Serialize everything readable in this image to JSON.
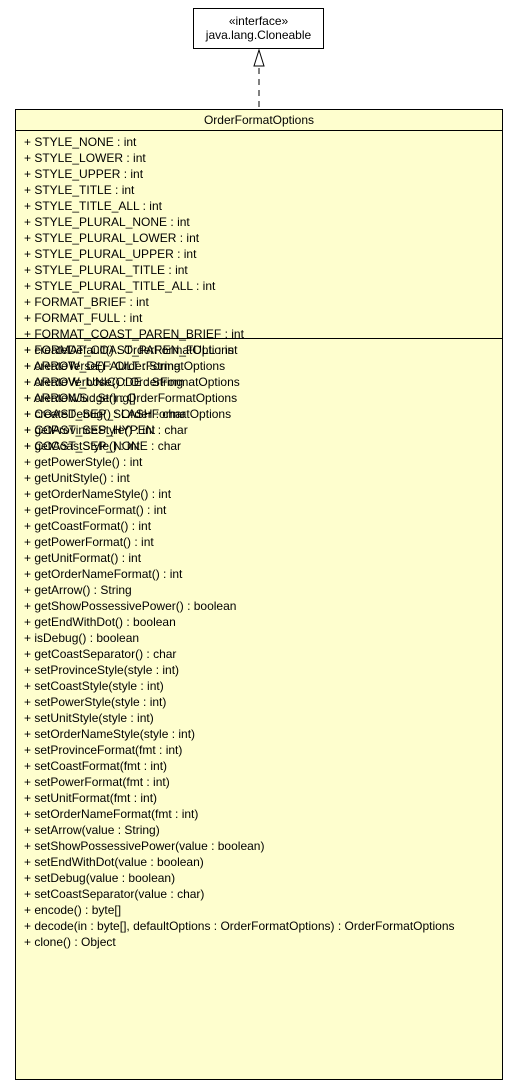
{
  "interface": {
    "stereotype": "«interface»",
    "name": "java.lang.Cloneable"
  },
  "class": {
    "name": "OrderFormatOptions",
    "attributes": [
      "+ STYLE_NONE : int",
      "+ STYLE_LOWER : int",
      "+ STYLE_UPPER : int",
      "+ STYLE_TITLE : int",
      "+ STYLE_TITLE_ALL : int",
      "+ STYLE_PLURAL_NONE : int",
      "+ STYLE_PLURAL_LOWER : int",
      "+ STYLE_PLURAL_UPPER : int",
      "+ STYLE_PLURAL_TITLE : int",
      "+ STYLE_PLURAL_TITLE_ALL : int",
      "+ FORMAT_BRIEF : int",
      "+ FORMAT_FULL : int",
      "+ FORMAT_COAST_PAREN_BRIEF : int",
      "+ FORMAT_COAST_PAREN_FULL : int",
      "+ ARROW_DEFAULT : String",
      "+ ARROW_UNICODE : String",
      "+ ARROWS : String[]",
      "+ COAST_SEP_SLASH : char",
      "+ COAST_SEP_HYPEN : char",
      "+ COAST_SEP_NONE : char"
    ],
    "methods": [
      "+ createDefault() : OrderFormatOptions",
      "+ createTerse() : OrderFormatOptions",
      "+ createVerbose() : OrderFormatOptions",
      "+ createNJudge() : OrderFormatOptions",
      "+ createDebug() : OrderFormatOptions",
      "+ getProvinceStyle() : int",
      "+ getCoastStyle() : int",
      "+ getPowerStyle() : int",
      "+ getUnitStyle() : int",
      "+ getOrderNameStyle() : int",
      "+ getProvinceFormat() : int",
      "+ getCoastFormat() : int",
      "+ getPowerFormat() : int",
      "+ getUnitFormat() : int",
      "+ getOrderNameFormat() : int",
      "+ getArrow() : String",
      "+ getShowPossessivePower() : boolean",
      "+ getEndWithDot() : boolean",
      "+ isDebug() : boolean",
      "+ getCoastSeparator() : char",
      "+ setProvinceStyle(style : int)",
      "+ setCoastStyle(style : int)",
      "+ setPowerStyle(style : int)",
      "+ setUnitStyle(style : int)",
      "+ setOrderNameStyle(style : int)",
      "+ setProvinceFormat(fmt : int)",
      "+ setCoastFormat(fmt : int)",
      "+ setPowerFormat(fmt : int)",
      "+ setUnitFormat(fmt : int)",
      "+ setOrderNameFormat(fmt : int)",
      "+ setArrow(value : String)",
      "+ setShowPossessivePower(value : boolean)",
      "+ setEndWithDot(value : boolean)",
      "+ setDebug(value : boolean)",
      "+ setCoastSeparator(value : char)",
      "+ encode() : byte[]",
      "+ decode(in : byte[], defaultOptions : OrderFormatOptions) : OrderFormatOptions",
      "+ clone() : Object"
    ]
  },
  "relationship": {
    "type": "realization",
    "from": "OrderFormatOptions",
    "to": "java.lang.Cloneable"
  },
  "colors": {
    "class_fill": "#fefece",
    "interface_fill": "#ffffff",
    "line": "#000000"
  }
}
